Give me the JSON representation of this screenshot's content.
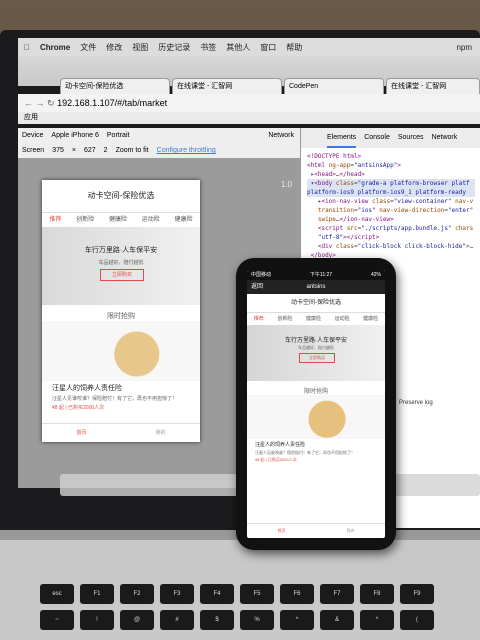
{
  "menubar": {
    "app": "Chrome",
    "items": [
      "文件",
      "修改",
      "视图",
      "历史记录",
      "书签",
      "其他人",
      "窗口",
      "帮助"
    ],
    "right": "npm"
  },
  "browser_tabs": [
    "动卡空间-保险优选",
    "在线课堂 - 汇智网",
    "CodePen",
    "在线课堂 - 汇智网"
  ],
  "address": "192.168.1.107/#/tab/market",
  "bookmarks_label": "应用",
  "device_toolbar": {
    "device_label": "Device",
    "device_value": "Apple iPhone 6",
    "orientation": "Portrait",
    "screen_label": "Screen",
    "width": "375",
    "height": "627",
    "dpr": "2",
    "zoom_label": "Zoom to fit",
    "network_label": "Network",
    "throttling": "Configure throttling",
    "zoom_value": "1.0"
  },
  "devtools": {
    "tabs": [
      "Elements",
      "Console",
      "Sources",
      "Network"
    ],
    "preserve_log": "Preserve log"
  },
  "app": {
    "title": "动卡空间-保险优选",
    "tabs": [
      "推荐",
      "创新险",
      "健康险",
      "运动险",
      "健康险"
    ],
    "banner_title": "车行万里路·人车保平安",
    "banner_sub": "车品越好，赔付越低",
    "banner_btn": "立即购买",
    "section": "限时抢购",
    "item_title": "汪星人的饲养人责任险",
    "item_desc": "汪星人见谁咬谁？保险赔付！有了它，再也不用担惊了！",
    "item_price": "¥8 起 | 已购买2000人次",
    "bottom_tabs": [
      "首页",
      "我的"
    ]
  },
  "phone": {
    "status_left": "中国移动",
    "status_time": "下午11:27",
    "status_right": "42%",
    "nav_back": "返回",
    "nav_title": "antsins",
    "item_price": "¥8 起 | 已购买2000人次"
  },
  "keyboard": {
    "row1": [
      "esc",
      "F1",
      "F2",
      "F3",
      "F4",
      "F5",
      "F6",
      "F7",
      "F8",
      "F9"
    ],
    "row2": [
      "~",
      "!",
      "@",
      "#",
      "$",
      "%",
      "^",
      "&",
      "*",
      "("
    ]
  }
}
